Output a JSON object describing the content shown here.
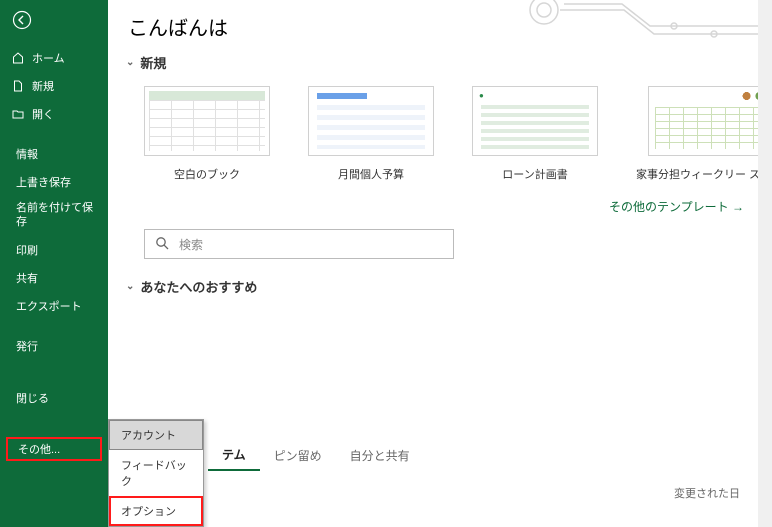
{
  "colors": {
    "brand": "#0e6b3a",
    "highlight": "#ff1a1a"
  },
  "greeting": "こんばんは",
  "sidebar": {
    "home": "ホーム",
    "new": "新規",
    "open": "開く",
    "info": "情報",
    "save": "上書き保存",
    "saveas": "名前を付けて保存",
    "print": "印刷",
    "share": "共有",
    "export": "エクスポート",
    "publish": "発行",
    "close": "閉じる",
    "more": "その他..."
  },
  "sections": {
    "new": "新規",
    "recommended": "あなたへのおすすめ"
  },
  "templates": [
    {
      "id": "blank",
      "label": "空白のブック"
    },
    {
      "id": "budget",
      "label": "月間個人予算"
    },
    {
      "id": "loan",
      "label": "ローン計画書"
    },
    {
      "id": "chore",
      "label": "家事分担ウィークリー スケジュ…"
    }
  ],
  "more_templates": "その他のテンプレート  →",
  "search": {
    "placeholder": "検索"
  },
  "popup": {
    "account": "アカウント",
    "feedback": "フィードバック",
    "options": "オプション"
  },
  "tabs": {
    "tab1_suffix": "テム",
    "pinned": "ピン留め",
    "shared": "自分と共有"
  },
  "modified_label": "変更された日"
}
